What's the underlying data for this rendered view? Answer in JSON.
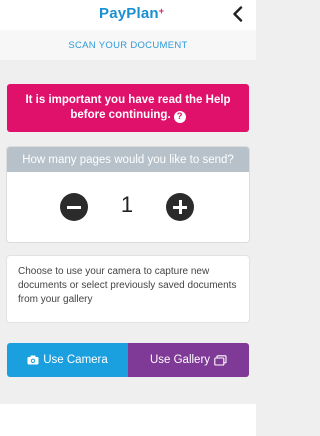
{
  "header": {
    "logo_text": "PayPlan",
    "logo_mark": "+",
    "back_icon": "chevron-left-icon"
  },
  "subtitle": "SCAN YOUR DOCUMENT",
  "help_banner": {
    "text": "It is important you have read the Help before continuing.",
    "icon": "question-circle-icon",
    "icon_glyph": "?",
    "background": "#e0116b"
  },
  "pages": {
    "question": "How many pages would you like to send?",
    "quantity": "1",
    "minus_icon": "minus-circle-icon",
    "plus_icon": "plus-circle-icon"
  },
  "info": {
    "text": "Choose to use your camera to capture new documents or select previously saved documents from your gallery"
  },
  "actions": {
    "camera_label": "Use Camera",
    "camera_icon": "camera-icon",
    "camera_color": "#1aa0de",
    "gallery_label": "Use Gallery",
    "gallery_icon": "gallery-icon",
    "gallery_color": "#7e3a96"
  }
}
